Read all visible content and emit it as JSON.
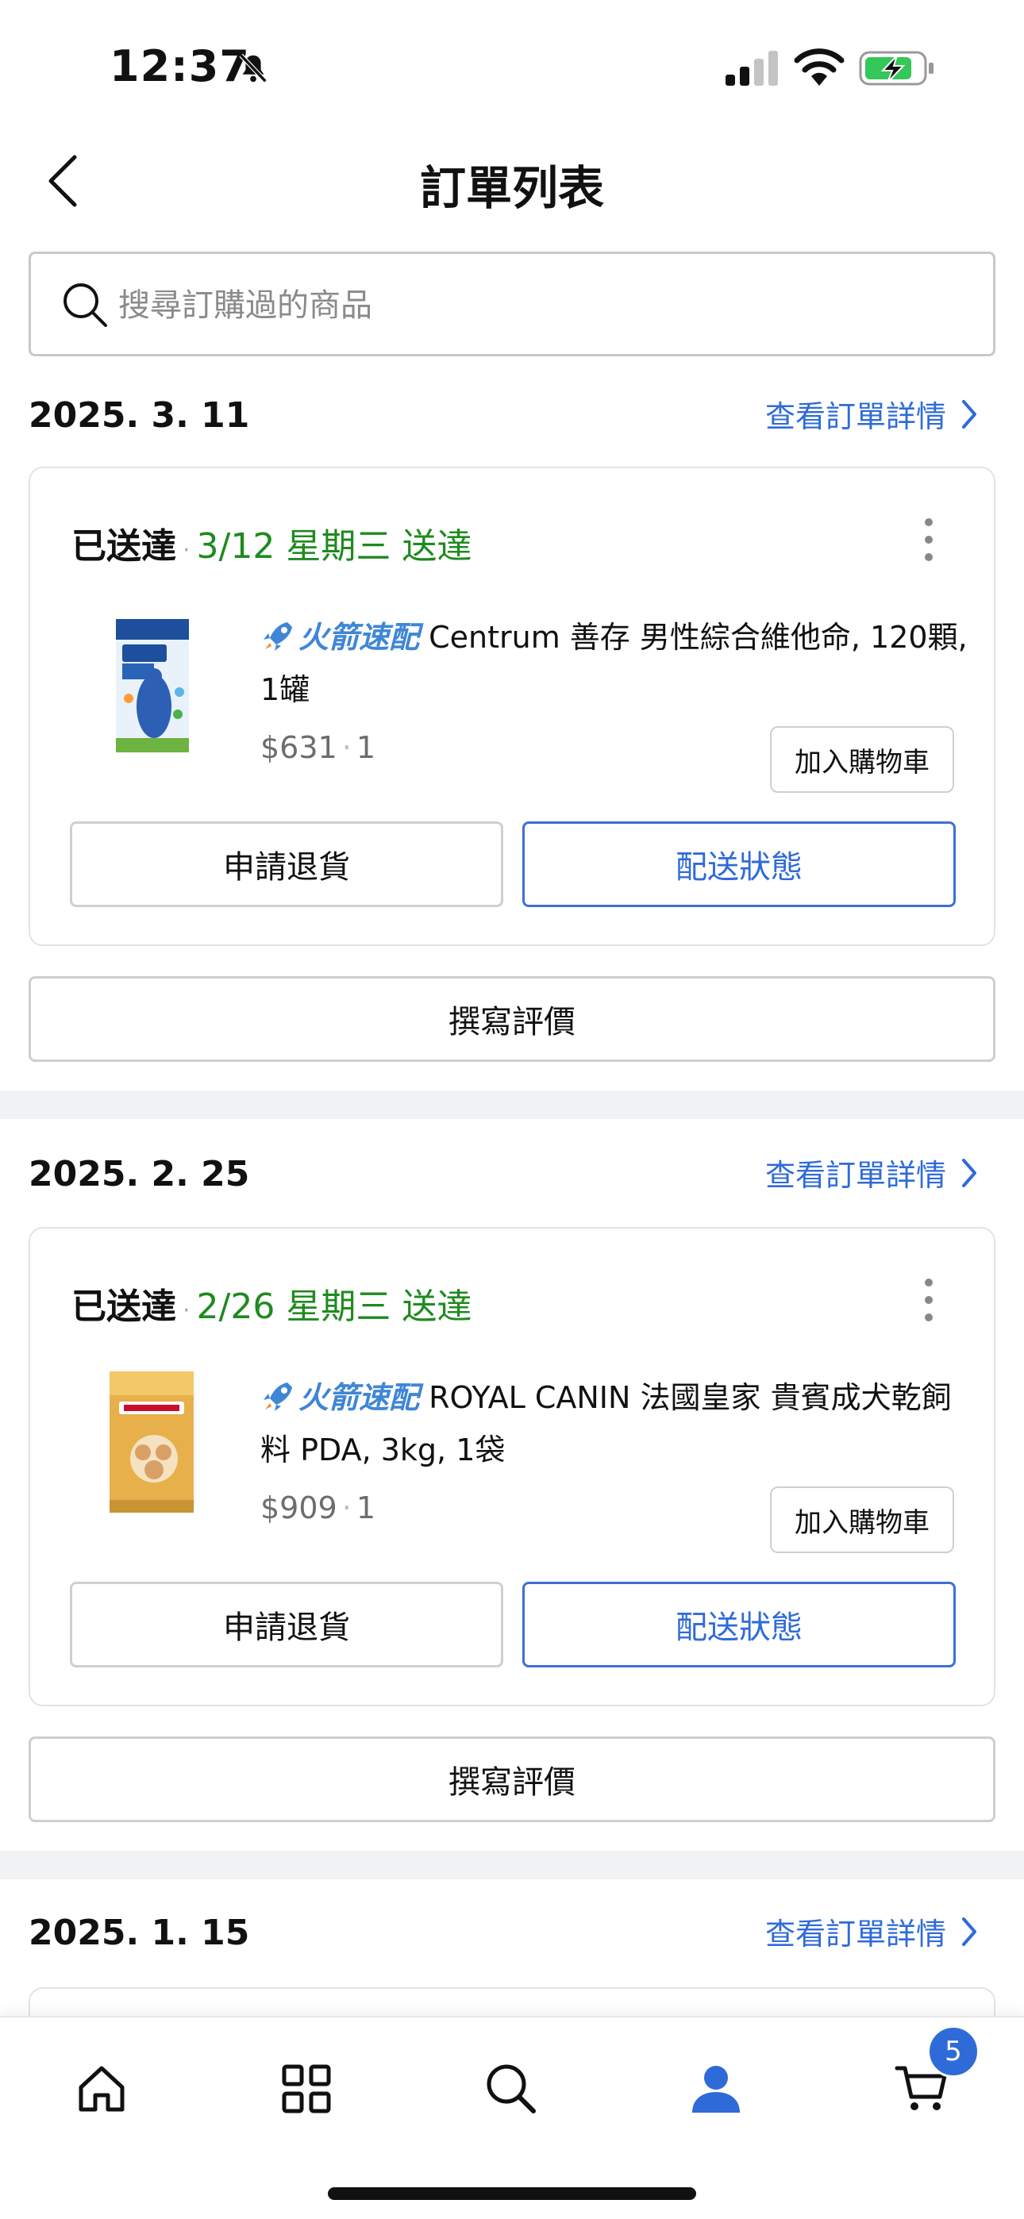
{
  "status_bar": {
    "time": "12:37"
  },
  "header": {
    "title": "訂單列表"
  },
  "search": {
    "placeholder": "搜尋訂購過的商品"
  },
  "orders": [
    {
      "date": "2025. 3. 11",
      "detail_link": "查看訂單詳情",
      "status": "已送達",
      "delivery_date": "3/12 星期三 送達",
      "badge": "火箭速配",
      "product_name": "Centrum 善存 男性綜合維他命, 120顆, 1罐",
      "price": "$631",
      "quantity": "1",
      "add_to_cart": "加入購物車",
      "return_button": "申請退貨",
      "delivery_button": "配送狀態",
      "review_button": "撰寫評價"
    },
    {
      "date": "2025. 2. 25",
      "detail_link": "查看訂單詳情",
      "status": "已送達",
      "delivery_date": "2/26 星期三 送達",
      "badge": "火箭速配",
      "product_name": "ROYAL CANIN 法國皇家 貴賓成犬乾飼料 PDA, 3kg, 1袋",
      "price": "$909",
      "quantity": "1",
      "add_to_cart": "加入購物車",
      "return_button": "申請退貨",
      "delivery_button": "配送狀態",
      "review_button": "撰寫評價"
    },
    {
      "date": "2025. 1. 15",
      "detail_link": "查看訂單詳情"
    }
  ],
  "tab_bar": {
    "items": [
      {
        "icon": "home-icon",
        "active": false
      },
      {
        "icon": "categories-icon",
        "active": false
      },
      {
        "icon": "search-icon",
        "active": false
      },
      {
        "icon": "profile-icon",
        "active": true
      },
      {
        "icon": "cart-icon",
        "active": false
      }
    ],
    "cart_count": "5"
  },
  "colors": {
    "accent": "#2f6bd8",
    "delivered_green": "#1f8a1f",
    "rocket_blue": "#3f86d6"
  }
}
